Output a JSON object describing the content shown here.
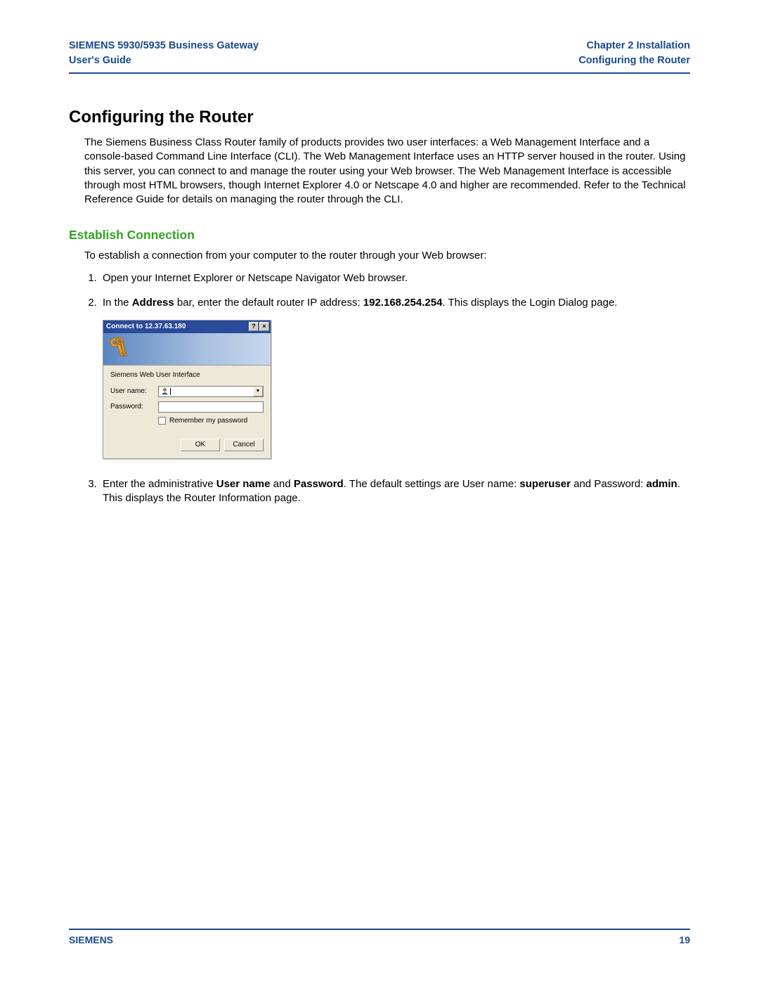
{
  "header": {
    "left_line1": "SIEMENS 5930/5935 Business Gateway",
    "left_line2": "User's Guide",
    "right_line1": "Chapter 2  Installation",
    "right_line2": "Configuring the Router"
  },
  "section_title": "Configuring the Router",
  "intro_paragraph": "The Siemens Business Class Router family of products provides two user interfaces: a Web Management Interface and a console-based Command Line Interface (CLI). The Web Management Interface uses an HTTP server housed in the router. Using this server, you can connect to and manage the router using your Web browser. The Web Management Interface is accessible through most HTML browsers, though Internet Explorer 4.0 or Netscape 4.0 and higher are recommended. Refer to the Technical Reference Guide for details on managing the router through the CLI.",
  "subsection_title": "Establish Connection",
  "sub_intro": "To establish a connection from your computer to the router through your Web browser:",
  "steps": {
    "s1": "Open your Internet Explorer or Netscape Navigator Web browser.",
    "s2_pre": "In the ",
    "s2_b1": "Address",
    "s2_mid": " bar, enter the default router IP address: ",
    "s2_b2": "192.168.254.254",
    "s2_post": ". This displays the Login Dialog page.",
    "s3_pre": "Enter the administrative ",
    "s3_b1": "User name",
    "s3_mid1": " and ",
    "s3_b2": "Password",
    "s3_mid2": ". The default settings are User name: ",
    "s3_b3": "superuser",
    "s3_mid3": " and Password: ",
    "s3_b4": "admin",
    "s3_post": ". This displays the Router Information page."
  },
  "dialog": {
    "title": "Connect to 12.37.63.180",
    "help_btn": "?",
    "close_btn": "×",
    "realm": "Siemens Web User Interface",
    "username_label": "User name:",
    "password_label": "Password:",
    "remember_label": "Remember my password",
    "ok": "OK",
    "cancel": "Cancel",
    "username_value": "",
    "password_value": ""
  },
  "footer": {
    "brand": "SIEMENS",
    "page": "19"
  }
}
